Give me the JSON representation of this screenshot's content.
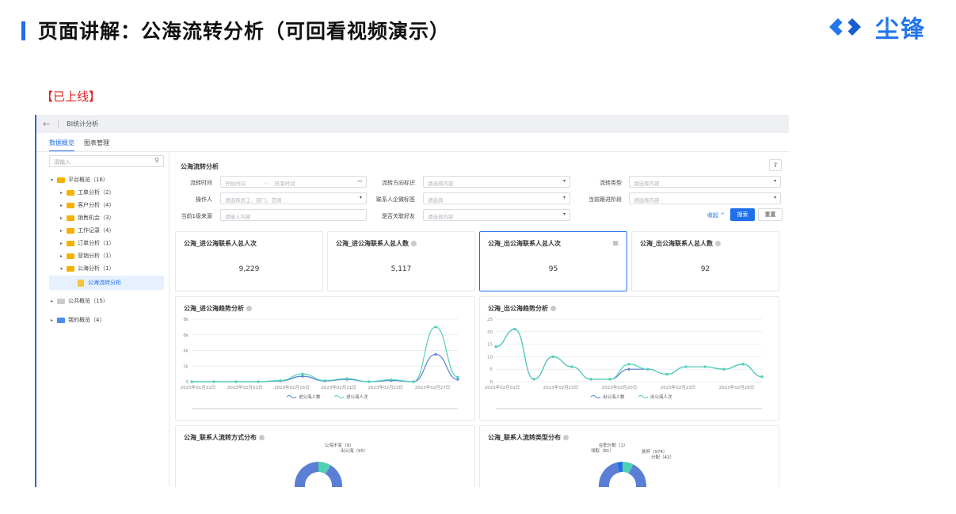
{
  "slide": {
    "title": "页面讲解：公海流转分析（可回看视频演示）",
    "logo_text": "尘锋",
    "status": "【已上线】"
  },
  "topbar": {
    "back_icon": "arrow-left-icon",
    "title": "BI统计分析"
  },
  "tabs": [
    {
      "label": "数据概览",
      "active": true
    },
    {
      "label": "图表管理",
      "active": false
    }
  ],
  "sidebar": {
    "search_placeholder": "请输入",
    "tree": [
      {
        "label": "平台概览（16）",
        "expanded": true
      },
      {
        "label": "工单分析（2）"
      },
      {
        "label": "客户分析（4）"
      },
      {
        "label": "销售机会（3）"
      },
      {
        "label": "工作记录（4）"
      },
      {
        "label": "订单分析（1）"
      },
      {
        "label": "营销分析（1）"
      },
      {
        "label": "公海分析（1）",
        "expanded": true
      },
      {
        "label": "公海流转分析",
        "selected": true
      },
      {
        "label": "公共概览（15）"
      },
      {
        "label": "我的概览（4）"
      }
    ]
  },
  "main": {
    "title": "公海流转分析",
    "filters": {
      "flow_time_label": "流转时间",
      "start_placeholder": "开始时间",
      "range_sep": "~",
      "end_placeholder": "结束时间",
      "direction_label": "流转方向标识",
      "direction_placeholder": "请选择内容",
      "type_label": "流转类型",
      "type_placeholder": "请选择内容",
      "operator_label": "操作人",
      "operator_placeholder": "请选择员工、部门、范围",
      "tag_label": "联系人企微标签",
      "tag_placeholder": "请选择",
      "stage_label": "当前跟进阶段",
      "stage_placeholder": "请选择内容",
      "source_label": "当前1级来源",
      "source_placeholder": "请输入内容",
      "friend_label": "是否关联好友",
      "friend_placeholder": "请选择内容",
      "collapse": "收起 ^",
      "search_btn": "搜索",
      "reset_btn": "重置"
    },
    "kpis": [
      {
        "title": "公海_进公海联系人总人次",
        "value": "9,229",
        "info": false
      },
      {
        "title": "公海_进公海联系人总人数",
        "value": "5,117",
        "info": true
      },
      {
        "title": "公海_出公海联系人总人次",
        "value": "95",
        "info": false,
        "active": true
      },
      {
        "title": "公海_出公海联系人总人数",
        "value": "92",
        "info": true
      }
    ]
  },
  "chart_data": [
    {
      "type": "line",
      "title": "公海_进公海趋势分析",
      "x_tick_labels": [
        "2023年01月31日",
        "2023年02月02日",
        "2023年02月16日",
        "2023年02月21日",
        "2023年02月23日",
        "2023年02月27日"
      ],
      "y_tick_labels": [
        "8k",
        "6k",
        "4k",
        "2k",
        "0"
      ],
      "ylim": [
        0,
        8000
      ],
      "x": [
        0,
        1,
        2,
        3,
        4,
        5,
        6,
        7,
        8,
        9,
        10,
        11
      ],
      "series": [
        {
          "name": "进公海人数",
          "color": "#5b7fd6",
          "values": [
            0,
            0,
            0,
            0,
            100,
            700,
            100,
            300,
            0,
            150,
            0,
            3500,
            300
          ]
        },
        {
          "name": "进公海人次",
          "color": "#4fd1b5",
          "values": [
            0,
            0,
            0,
            0,
            150,
            1000,
            150,
            400,
            0,
            250,
            0,
            7000,
            600
          ]
        }
      ],
      "grid": true,
      "legend": "bottom"
    },
    {
      "type": "line",
      "title": "公海_出公海趋势分析",
      "x_tick_labels": [
        "2023年02月01日",
        "2023年02月15日",
        "2023年02月20日",
        "2023年02月23日",
        "2023年02月28日"
      ],
      "y_tick_labels": [
        "25",
        "20",
        "15",
        "10",
        "5",
        "0"
      ],
      "ylim": [
        0,
        25
      ],
      "x": [
        0,
        1,
        2,
        3,
        4,
        5,
        6,
        7,
        8,
        9,
        10,
        11,
        12,
        13,
        14
      ],
      "series": [
        {
          "name": "出公海人数",
          "color": "#5b7fd6",
          "values": [
            14,
            21,
            1,
            10,
            6,
            1,
            1,
            5,
            5,
            3,
            6,
            6,
            5,
            7,
            2
          ]
        },
        {
          "name": "出公海人次",
          "color": "#4fd1b5",
          "values": [
            14,
            21,
            1,
            10,
            6,
            1,
            1,
            7,
            5,
            3,
            6,
            6,
            5,
            7,
            2
          ]
        }
      ],
      "grid": true,
      "legend": "bottom"
    },
    {
      "type": "pie",
      "title": "公海_联系人流转方式分布",
      "labels": [
        "公海不变（9）",
        "出公海（95）"
      ],
      "values": [
        9,
        95
      ],
      "colors": [
        "#4fd1b5",
        "#5b7fd6"
      ]
    },
    {
      "type": "pie",
      "title": "公海_联系人流转类型分布",
      "labels": [
        "在职分配（1）",
        "领取（81）",
        "放弃（974）",
        "分配（42）"
      ],
      "values": [
        1,
        81,
        974,
        42
      ],
      "colors": [
        "#f5b100",
        "#4fd1b5",
        "#5b7fd6",
        "#1f6fe8"
      ]
    }
  ]
}
